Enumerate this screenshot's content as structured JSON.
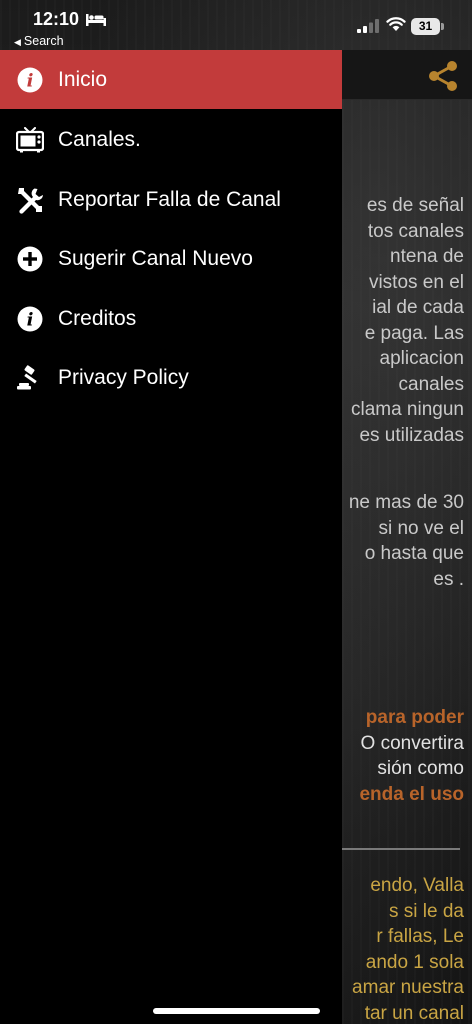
{
  "status_bar": {
    "time": "12:10",
    "back_label": "Search",
    "battery": "31"
  },
  "drawer": {
    "items": [
      {
        "label": "Inicio",
        "icon": "info-icon",
        "active": true
      },
      {
        "label": "Canales.",
        "icon": "tv-icon",
        "active": false
      },
      {
        "label": "Reportar Falla de Canal",
        "icon": "tools-icon",
        "active": false
      },
      {
        "label": "Sugerir Canal Nuevo",
        "icon": "plus-circle-icon",
        "active": false
      },
      {
        "label": "Creditos",
        "icon": "info-icon",
        "active": false
      },
      {
        "label": "Privacy Policy",
        "icon": "gavel-icon",
        "active": false
      }
    ]
  },
  "background": {
    "share_icon": "share-icon",
    "accent_color": "#c23b3b",
    "paragraph1": [
      "es de señal",
      "tos canales",
      "ntena de",
      "vistos en el",
      "ial de cada",
      "e paga. Las",
      "aplicacion",
      "canales",
      "clama ningun",
      "es utilizadas"
    ],
    "paragraph2": [
      "ne mas de 30",
      "si no ve el",
      "o hasta que",
      "es ."
    ],
    "paragraph3": {
      "line1": "para poder",
      "line2": "O convertira",
      "line3": "sión como",
      "line4": "enda el uso"
    },
    "paragraph4": [
      "endo, Valla",
      "s si le da",
      "r fallas, Le",
      "ando 1 sola",
      "amar nuestra",
      "tar un canal"
    ]
  }
}
